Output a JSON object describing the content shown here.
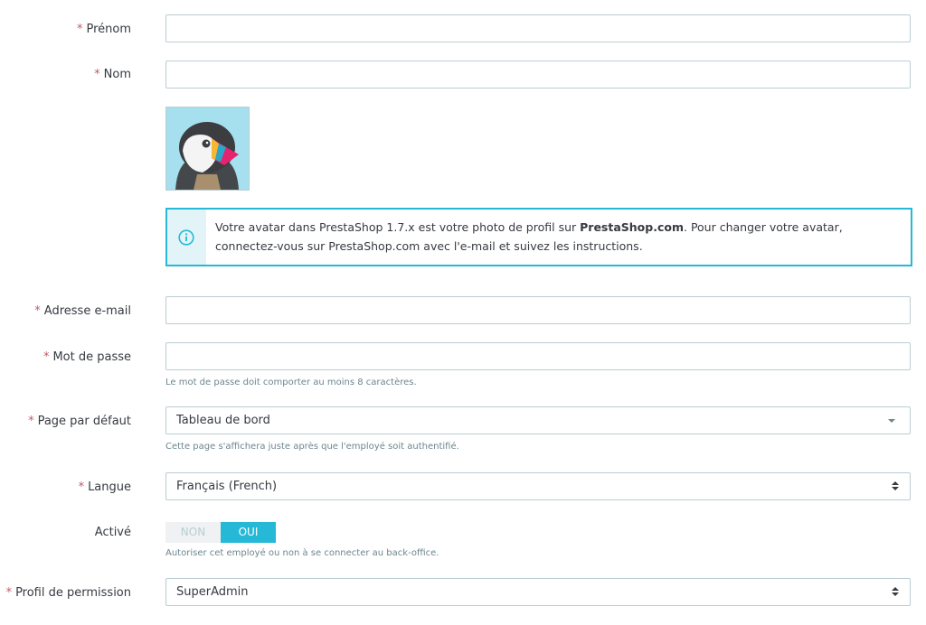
{
  "form": {
    "firstname": {
      "label": "Prénom",
      "required": "*",
      "value": ""
    },
    "lastname": {
      "label": "Nom",
      "required": "*",
      "value": ""
    },
    "avatar": {
      "icon": "prestashop-puffin-avatar"
    },
    "info_box": {
      "icon": "info-icon",
      "text_before": "Votre avatar dans PrestaShop 1.7.x est votre photo de profil sur ",
      "link_text": "PrestaShop.com",
      "text_after": ". Pour changer votre avatar, connectez-vous sur PrestaShop.com avec l'e-mail et suivez les instructions."
    },
    "email": {
      "label": "Adresse e-mail",
      "required": "*",
      "value": ""
    },
    "password": {
      "label": "Mot de passe",
      "required": "*",
      "value": "",
      "help": "Le mot de passe doit comporter au moins 8 caractères."
    },
    "default_page": {
      "label": "Page par défaut",
      "required": "*",
      "value": "Tableau de bord",
      "help": "Cette page s'affichera juste après que l'employé soit authentifié."
    },
    "language": {
      "label": "Langue",
      "required": "*",
      "value": "Français (French)"
    },
    "active": {
      "label": "Activé",
      "off_label": "NON",
      "on_label": "OUI",
      "selected": "OUI",
      "help": "Autoriser cet employé ou non à se connecter au back-office."
    },
    "profile": {
      "label": "Profil de permission",
      "required": "*",
      "value": "SuperAdmin"
    }
  },
  "colors": {
    "accent": "#25b9d7",
    "required": "#c05c67",
    "border": "#bbcdd2",
    "info_bg": "#e2f4f8",
    "avatar_bg": "#a6dfee"
  }
}
